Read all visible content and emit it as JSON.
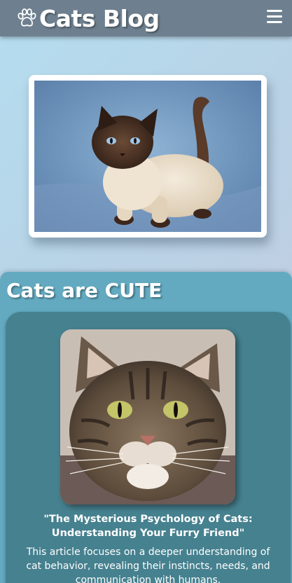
{
  "header": {
    "brand": "Cats Blog",
    "logo_icon": "paw-icon",
    "menu_icon": "hamburger-menu-icon"
  },
  "hero": {
    "image": "siamese-cat-photo"
  },
  "section": {
    "title": "Cats are CUTE"
  },
  "article": {
    "image": "tabby-cat-photo",
    "title": "\"The Mysterious Psychology of Cats: Understanding Your Furry Friend\"",
    "excerpt": "This article focuses on a deeper understanding of cat behavior, revealing their instincts, needs, and communication with humans."
  },
  "colors": {
    "header": "#6e8090",
    "section": "#63aac1",
    "card": "#46818f"
  }
}
